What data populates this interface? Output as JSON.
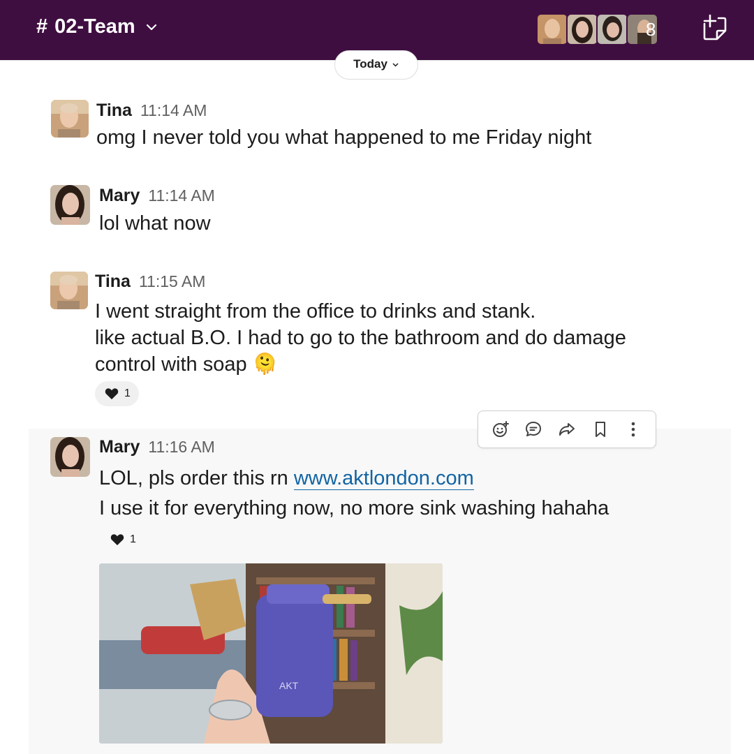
{
  "header": {
    "hash": "#",
    "channel_name": "02-Team",
    "member_count": "8",
    "icons": {
      "dropdown": "chevron-down-icon",
      "compose": "new-message-icon"
    }
  },
  "date_divider": {
    "label": "Today"
  },
  "messages": [
    {
      "author": "Tina",
      "time": "11:14 AM",
      "lines": [
        "omg I never told you what happened to me Friday night"
      ]
    },
    {
      "author": "Mary",
      "time": "11:14 AM",
      "lines": [
        "lol what now"
      ]
    },
    {
      "author": "Tina",
      "time": "11:15 AM",
      "lines": [
        "I went straight from the office to drinks and stank.",
        "like actual B.O. I had to go to the bathroom and do damage",
        "control with soap"
      ],
      "emoji": "🫠",
      "reaction": {
        "icon": "heart-icon",
        "count": "1"
      }
    },
    {
      "author": "Mary",
      "time": "11:16 AM",
      "line1_prefix": "LOL, pls order this rn ",
      "link": "www.aktlondon.com",
      "lines": [
        "I use it for everything now, no more sink washing hahaha"
      ],
      "reaction": {
        "icon": "heart-icon",
        "count": "1"
      },
      "attachment": {
        "type": "image"
      }
    }
  ],
  "message_toolbar": {
    "actions": [
      "add-reaction-icon",
      "reply-in-thread-icon",
      "share-icon",
      "save-bookmark-icon",
      "more-actions-icon"
    ]
  },
  "colors": {
    "header_bg": "#3f0e40",
    "link": "#1264a3",
    "hover_bg": "#f8f8f8"
  }
}
